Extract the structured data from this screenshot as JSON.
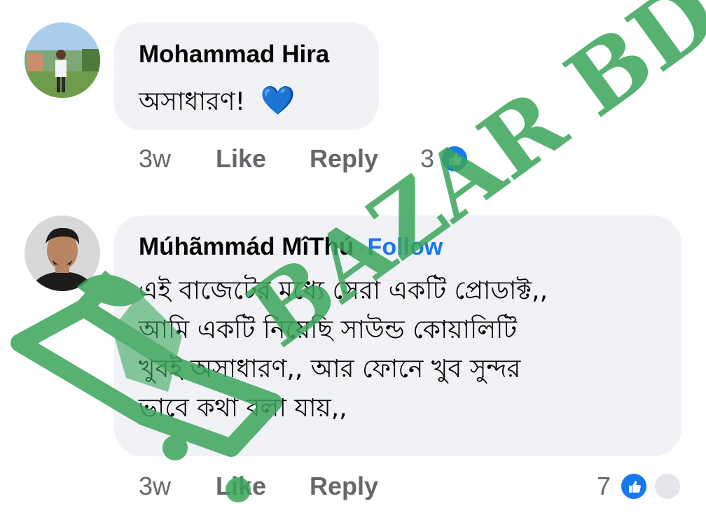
{
  "comments": [
    {
      "author": "Mohammad Hira",
      "text_lines": [
        "অসাধারণ!"
      ],
      "emoji": "💙",
      "time": "3w",
      "like_label": "Like",
      "reply_label": "Reply",
      "reaction_count": "3"
    },
    {
      "author": "Múhãmmád MîThú",
      "separator": "·",
      "follow_label": "Follow",
      "text_lines": [
        "এই বাজেটের মধ্যে সেরা একটি প্রোডাক্ট,,",
        "আমি একটি নিয়েছি সাউন্ড কোয়ালিটি",
        "খুবই অসাধারণ,, আর ফোনে খুব সুন্দর",
        "ভাবে কথা বলা যায়,,"
      ],
      "time": "3w",
      "like_label": "Like",
      "reply_label": "Reply",
      "reaction_count": "7"
    }
  ],
  "watermark": {
    "text": "BAZAR BD",
    "color": "#3aa55a"
  },
  "colors": {
    "bubble": "#f0f2f5",
    "meta": "#65676b",
    "follow": "#1877f2",
    "like_badge": "#1877f2"
  }
}
